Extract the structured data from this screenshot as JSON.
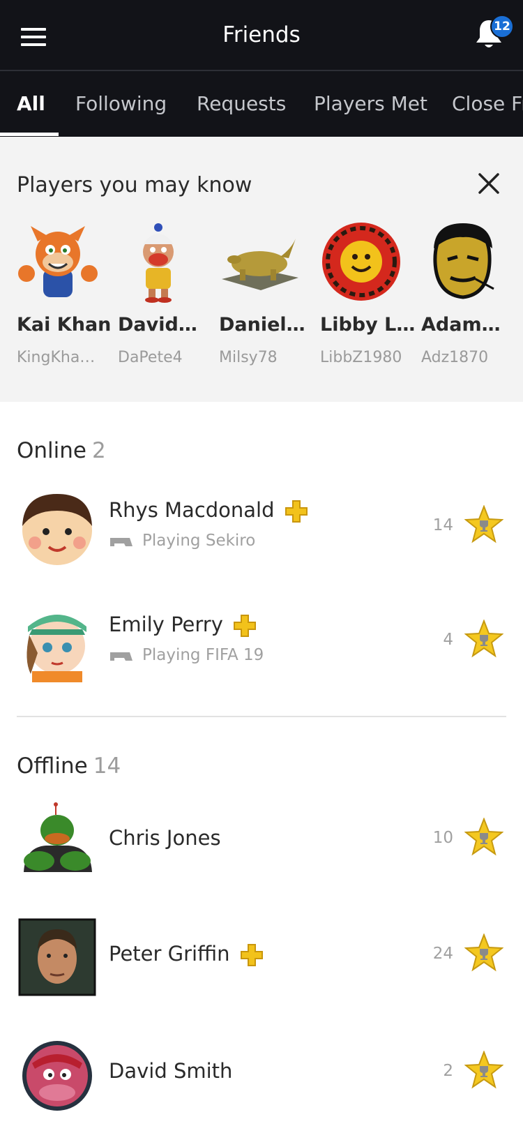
{
  "header": {
    "title": "Friends",
    "notification_count": "12"
  },
  "tabs": [
    {
      "label": "All"
    },
    {
      "label": "Following"
    },
    {
      "label": "Requests"
    },
    {
      "label": "Players Met"
    },
    {
      "label": "Close Fr"
    }
  ],
  "suggestions": {
    "title": "Players you may know",
    "people": [
      {
        "name": "Kai Khan",
        "handle": "KingKha…"
      },
      {
        "name": "David…",
        "handle": "DaPete4"
      },
      {
        "name": "Daniel…",
        "handle": "Milsy78"
      },
      {
        "name": "Libby L…",
        "handle": "LibbZ1980"
      },
      {
        "name": "Adam…",
        "handle": "Adz1870"
      }
    ]
  },
  "online": {
    "label": "Online",
    "count": "2",
    "friends": [
      {
        "name": "Rhys Macdonald",
        "status": "Playing Sekiro",
        "level": "14"
      },
      {
        "name": "Emily Perry",
        "status": "Playing FIFA 19",
        "level": "4"
      }
    ]
  },
  "offline": {
    "label": "Offline",
    "count": "14",
    "friends": [
      {
        "name": "Chris Jones",
        "level": "10"
      },
      {
        "name": "Peter Griffin",
        "level": "24"
      },
      {
        "name": "David Smith",
        "level": "2"
      }
    ]
  },
  "colors": {
    "header_bg": "#121318",
    "badge": "#1a6fd6",
    "plus_gold": "#f2c21b",
    "trophy_gold": "#f4c820"
  }
}
